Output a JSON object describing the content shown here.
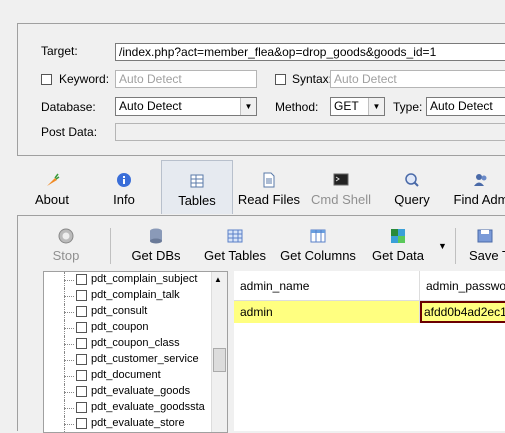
{
  "form": {
    "target_label": "Target:",
    "target_value": "/index.php?act=member_flea&op=drop_goods&goods_id=1",
    "keyword_label": "Keyword:",
    "keyword_placeholder": "Auto Detect",
    "syntax_label": "Syntax:",
    "syntax_placeholder": "Auto Detect",
    "database_label": "Database:",
    "database_value": "Auto Detect",
    "method_label": "Method:",
    "method_value": "GET",
    "type_label": "Type:",
    "type_value": "Auto Detect",
    "postdata_label": "Post Data:",
    "postdata_value": ""
  },
  "tabs": [
    {
      "label": "About",
      "icon": "carrot-icon"
    },
    {
      "label": "Info",
      "icon": "info-icon"
    },
    {
      "label": "Tables",
      "icon": "table-icon"
    },
    {
      "label": "Read Files",
      "icon": "file-icon"
    },
    {
      "label": "Cmd Shell",
      "icon": "terminal-icon"
    },
    {
      "label": "Query",
      "icon": "query-icon"
    },
    {
      "label": "Find Adm",
      "icon": "users-icon"
    }
  ],
  "toolbar": [
    {
      "label": "Stop",
      "icon": "stop-icon"
    },
    {
      "label": "Get DBs",
      "icon": "database-icon"
    },
    {
      "label": "Get Tables",
      "icon": "tables-icon"
    },
    {
      "label": "Get Columns",
      "icon": "columns-icon"
    },
    {
      "label": "Get Data",
      "icon": "data-icon"
    },
    {
      "label": "Save T",
      "icon": "save-icon"
    }
  ],
  "tree_items": [
    "pdt_complain_subject",
    "pdt_complain_talk",
    "pdt_consult",
    "pdt_coupon",
    "pdt_coupon_class",
    "pdt_customer_service",
    "pdt_document",
    "pdt_evaluate_goods",
    "pdt_evaluate_goodssta",
    "pdt_evaluate_store"
  ],
  "grid": {
    "columns": [
      "admin_name",
      "admin_passwor"
    ],
    "rows": [
      [
        "admin",
        "afdd0b4ad2ec1"
      ]
    ]
  },
  "colors": {
    "row_highlight": "#ffff80",
    "selected_border": "#6b0000"
  }
}
